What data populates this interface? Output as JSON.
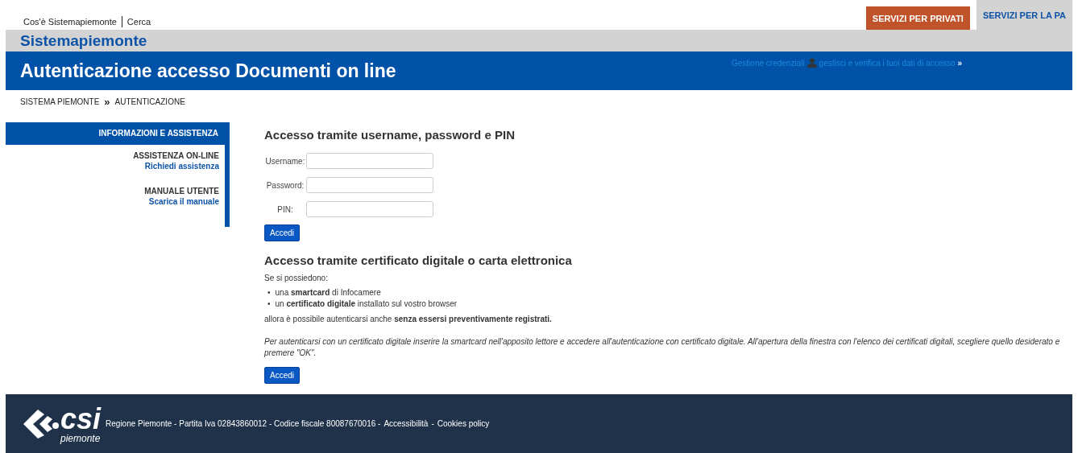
{
  "top_links": [
    "Cos'è Sistemapiemonte",
    "Cerca"
  ],
  "tabs": [
    {
      "label": "SERVIZI PER PRIVATI",
      "selected": false
    },
    {
      "label": "SERVIZI PER LA PA",
      "selected": true
    }
  ],
  "site_name": "Sistemapiemonte",
  "page_title": "Autenticazione accesso Documenti on line",
  "credentials": {
    "label": "Gestione credenziali",
    "link": "gestisci e verifica i tuoi dati di accesso",
    "arrow": "»"
  },
  "breadcrumb": {
    "items": [
      "SISTEMA PIEMONTE",
      "AUTENTICAZIONE"
    ],
    "separator": "»"
  },
  "sidebar": {
    "title": "INFORMAZIONI E ASSISTENZA",
    "sections": [
      {
        "heading": "ASSISTENZA ON-LINE",
        "link": "Richiedi assistenza"
      },
      {
        "heading": "MANUALE UTENTE",
        "link": "Scarica il manuale"
      }
    ]
  },
  "login_form": {
    "title": "Accesso tramite username, password e PIN",
    "fields": [
      {
        "label": "Username:"
      },
      {
        "label": "Password:"
      },
      {
        "label": "PIN:"
      }
    ],
    "button": "Accedi"
  },
  "certificate": {
    "title": "Accesso tramite certificato digitale o carta elettronica",
    "intro": "Se si possiedono:",
    "bullet": "•",
    "items": [
      "una **smartcard** di Infocamere",
      "un **certificato digitale** installato sul vostro browser"
    ],
    "conclusion": "allora è possibile autenticarsi anche **senza essersi preventivamente registrati.**",
    "note": "Per autenticarsi con un certificato digitale inserire la smartcard nell'apposito lettore e accedere all'autenticazione con certificato digitale. All'apertura della finestra con l'elenco dei certificati digitali, scegliere quello desiderato e premere \"OK\".",
    "button": "Accedi"
  },
  "footer": {
    "logo_text": "csi",
    "logo_sub": "piemonte",
    "text": "Regione Piemonte - Partita Iva 02843860012 - Codice fiscale 80087670016 -",
    "links": [
      "Accessibilità",
      "Cookies policy"
    ],
    "separator": "-"
  }
}
